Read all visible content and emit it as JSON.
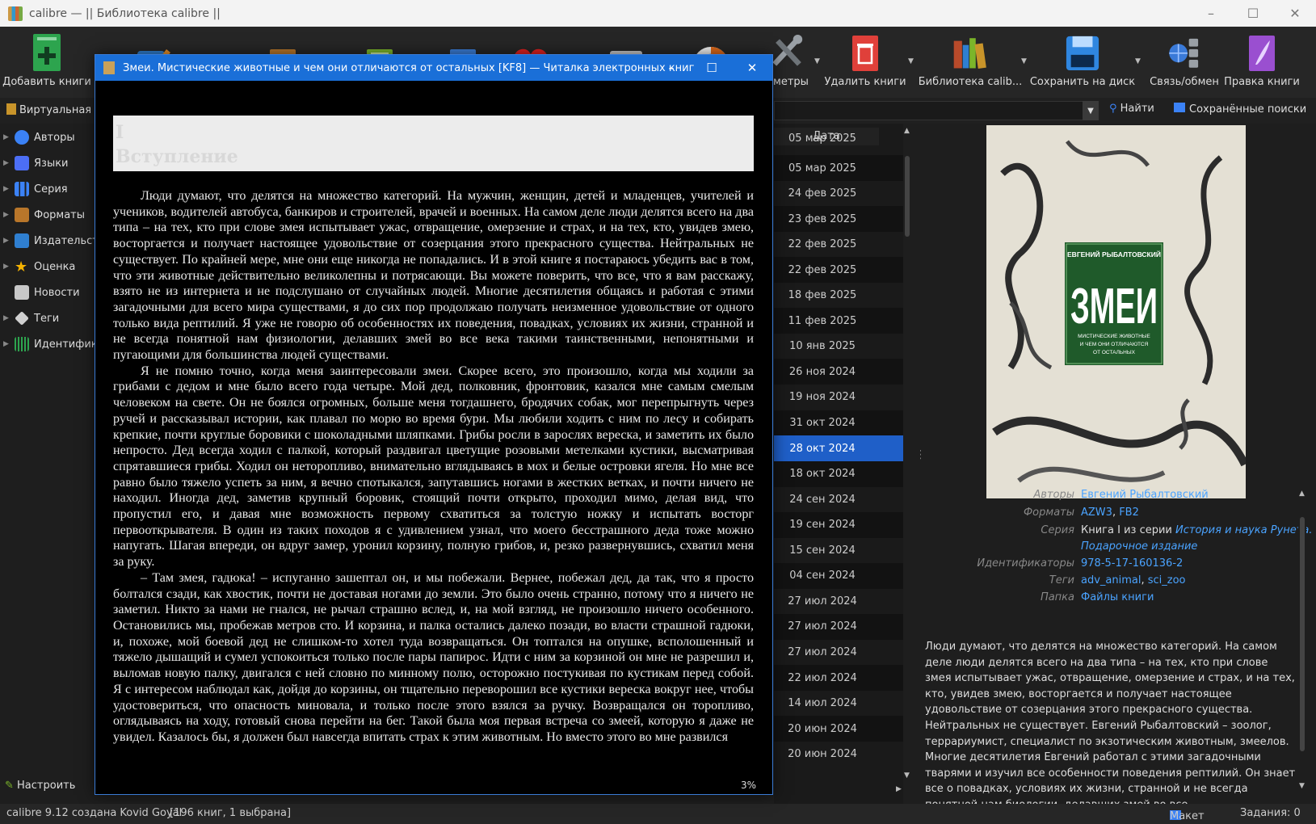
{
  "window": {
    "title": "calibre — || Библиотека calibre ||",
    "controls": [
      "–",
      "☐",
      "✕"
    ]
  },
  "toolbar": {
    "buttons": [
      {
        "label": "Добавить книги",
        "icon": "add-book-icon",
        "color": "#2da44e"
      },
      {
        "label": "",
        "icon": "edit-metadata-icon",
        "color": "#2f7fd0"
      },
      {
        "label": "",
        "icon": "convert-books-icon",
        "color": "#b8762a"
      },
      {
        "label": "",
        "icon": "view-book-icon",
        "color": "#7bb52a"
      },
      {
        "label": "",
        "icon": "get-books-icon",
        "color": "#3b7ed8"
      },
      {
        "label": "",
        "icon": "donate-heart-icon",
        "color": "#e02020"
      },
      {
        "label": "",
        "icon": "fetch-news-icon",
        "color": "#c8c8c8"
      },
      {
        "label": "",
        "icon": "help-lifebuoy-icon",
        "color": "#e06a1a"
      },
      {
        "label": "аметры",
        "icon": "preferences-icon",
        "color": "#9aa0a6"
      },
      {
        "label": "Удалить книги",
        "icon": "remove-books-icon",
        "color": "#e0403a"
      },
      {
        "label": "Библиотека calib...",
        "icon": "library-icon",
        "color": "#c8942a"
      },
      {
        "label": "Сохранить на диск",
        "icon": "save-to-disk-icon",
        "color": "#2f86e0"
      },
      {
        "label": "Связь/обмен",
        "icon": "connect-share-icon",
        "color": "#3a7ad8"
      },
      {
        "label": "Правка книги",
        "icon": "edit-book-icon",
        "color": "#9a4fd0"
      }
    ]
  },
  "library_bar": {
    "virtual_library": "Виртуальная би",
    "find": "Найти",
    "saved_searches": "Сохранённые поиски"
  },
  "tag_browser": {
    "items": [
      {
        "label": "Авторы",
        "icon": "authors-icon",
        "color": "#3b82f6"
      },
      {
        "label": "Языки",
        "icon": "languages-icon",
        "color": "#4c6ef5"
      },
      {
        "label": "Серия",
        "icon": "series-icon",
        "color": "#3b82f6"
      },
      {
        "label": "Форматы",
        "icon": "formats-icon",
        "color": "#b8762a"
      },
      {
        "label": "Издательств",
        "icon": "publisher-icon",
        "color": "#2f7fd0"
      },
      {
        "label": "Оценка",
        "icon": "rating-star-icon",
        "color": "#f5b301"
      },
      {
        "label": "Новости",
        "icon": "news-icon",
        "color": "#c8c8c8"
      },
      {
        "label": "Теги",
        "icon": "tags-icon",
        "color": "#d0d0d0"
      },
      {
        "label": "Идентифика",
        "icon": "identifiers-icon",
        "color": "#2da44e"
      }
    ],
    "configure": "Настроить"
  },
  "book_list": {
    "date_header": "Дата",
    "dates": [
      "05 мар 2025",
      "05 мар 2025",
      "24 фев 2025",
      "23 фев 2025",
      "22 фев 2025",
      "22 фев 2025",
      "18 фев 2025",
      "11 фев 2025",
      "10 янв 2025",
      "26 ноя 2024",
      "19 ноя 2024",
      "31 окт 2024",
      "28 окт 2024",
      "18 окт 2024",
      "24 сен 2024",
      "19 сен 2024",
      "15 сен 2024",
      "04 сен 2024",
      "27 июл 2024",
      "27 июл 2024",
      "27 июл 2024",
      "22 июл 2024",
      "14 июл 2024",
      "20 июн 2024",
      "20 июн 2024"
    ],
    "selected_index": 12
  },
  "details": {
    "cover": {
      "author": "ЕВГЕНИЙ РЫБАЛТОВСКИЙ",
      "title": "ЗМЕИ",
      "subtitle": [
        "МИСТИЧЕСКИЕ ЖИВОТНЫЕ",
        "И ЧЕМ ОНИ ОТЛИЧАЮТСЯ",
        "ОТ ОСТАЛЬНЫХ"
      ]
    },
    "fields": {
      "authors_label": "Авторы",
      "authors": "Евгений Рыбалтовский",
      "formats_label": "Форматы",
      "format_1": "AZW3",
      "format_2": "FB2",
      "series_label": "Серия",
      "series_prefix": "Книга I из серии",
      "series_name": "История и наука Рунета.",
      "series_name_2": "Подарочное издание",
      "identifiers_label": "Идентификаторы",
      "identifiers": "978-5-17-160136-2",
      "tags_label": "Теги",
      "tag_1": "adv_animal",
      "tag_2": "sci_zoo",
      "folder_label": "Папка",
      "folder": "Файлы книги"
    },
    "summary": "Люди думают, что делятся на множество категорий. На самом деле люди делятся всего на два типа – на тех, кто при слове змея испытывает ужас, отвращение, омерзение и страх, и на тех, кто, увидев змею, восторгается и получает настоящее удовольствие от созерцания этого прекрасного существа. Нейтральных не существует. Евгений Рыбалтовский – зоолог, террариумист, специалист по экзотическим животным, змеелов. Многие десятилетия Евгений работал с этими загадочными тварями и изучил все особенности поведения рептилий. Он знает все о повадках, условиях их жизни, странной и не всегда понятной нам биологии, делавших змей во все"
  },
  "statusbar": {
    "left": "calibre 9.12 создана Kovid Goyal",
    "count": "[196 книг, 1 выбрана]",
    "layout": "Макет",
    "jobs": "Задания: 0"
  },
  "viewer": {
    "title": "Змеи. Мистические животные и чем они отличаются от остальных [KF8] — Читалка электронных книг",
    "chapter_line1": "I",
    "chapter_line2": "Вступление",
    "paragraphs": [
      "Люди думают, что делятся на множество категорий. На мужчин, женщин, детей и младенцев, учителей и учеников, водителей автобуса, банкиров и строителей, врачей и военных. На самом деле люди делятся всего на два типа – на тех, кто при слове змея испытывает ужас, отвращение, омерзение и страх, и на тех, кто, увидев змею, восторгается и получает настоящее удовольствие от созерцания этого прекрасного существа. Нейтральных не существует. По крайней мере, мне они еще никогда не попадались. И в этой книге я постараюсь убедить вас в том, что эти животные действительно великолепны и потрясающи. Вы можете поверить, что все, что я вам расскажу, взято не из интернета и не подслушано от случайных людей. Многие десятилетия общаясь и работая с этими загадочными для всего мира существами, я до сих пор продолжаю получать неизменное удовольствие от одного только вида рептилий. Я уже не говорю об особенностях их поведения, повадках, условиях их жизни, странной и не всегда понятной нам физиологии, делавших змей во все века такими таинственными, непонятными и пугающими для большинства людей существами.",
      "Я не помню точно, когда меня заинтересовали змеи. Скорее всего, это произошло, когда мы ходили за грибами с дедом и мне было всего года четыре. Мой дед, полковник, фронтовик, казался мне самым смелым человеком на свете. Он не боялся огромных, больше меня тогдашнего, бродячих собак, мог перепрыгнуть через ручей и рассказывал истории, как плавал по морю во время бури. Мы любили ходить с ним по лесу и собирать крепкие, почти круглые боровики с шоколадными шляпками. Грибы росли в зарослях вереска, и заметить их было непросто. Дед всегда ходил с палкой, который раздвигал цветущие розовыми метелками кустики, высматривая спрятавшиеся грибы. Ходил он неторопливо, внимательно вглядываясь в мох и белые островки ягеля. Но мне все равно было тяжело успеть за ним, я вечно спотыкался, запутавшись ногами в жестких ветках, и почти ничего не находил. Иногда дед, заметив крупный боровик, стоящий почти открыто, проходил мимо, делая вид, что пропустил его, и давая мне возможность первому схватиться за толстую ножку и испытать восторг первооткрывателя. В один из таких походов я с удивлением узнал, что моего бесстрашного деда тоже можно напугать. Шагая впереди, он вдруг замер, уронил корзину, полную грибов, и, резко развернувшись, схватил меня за руку.",
      "– Там змея, гадюка! – испуганно зашептал он, и мы побежали. Вернее, побежал дед, да так, что я просто болтался сзади, как хвостик, почти не доставая ногами до земли. Это было очень странно, потому что я ничего не заметил. Никто за нами не гнался, не рычал страшно вслед, и, на мой взгляд, не произошло ничего особенного. Остановились мы, пробежав метров сто. И корзина, и палка остались далеко позади, во власти страшной гадюки, и, похоже, мой боевой дед не слишком-то хотел туда возвращаться. Он топтался на опушке, всполошенный и тяжело дышащий и сумел успокоиться только после пары папирос. Идти с ним за корзиной он мне не разрешил и, выломав новую палку, двигался с ней словно по минному полю, осторожно постукивая по кустикам перед собой. Я с интересом наблюдал как, дойдя до корзины, он тщательно переворошил все кустики вереска вокруг нее, чтобы удостовериться, что опасность миновала, и только после этого взялся за ручку. Возвращался он торопливо, оглядываясь на ходу, готовый снова перейти на бег. Такой была моя первая встреча со змеей, которую я даже не увидел. Казалось бы, я должен был навсегда впитать страх к этим животным. Но вместо этого во мне развился"
    ],
    "progress": "3%"
  }
}
